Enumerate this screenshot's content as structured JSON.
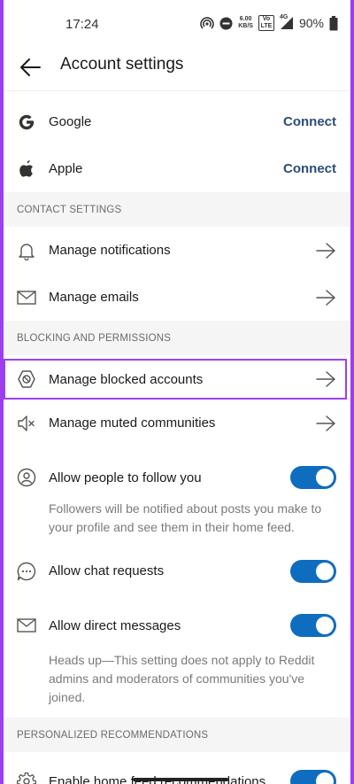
{
  "status_bar": {
    "time": "17:24",
    "net_speed_value": "6.00",
    "net_speed_unit": "KB/S",
    "volte": "Vo LTE",
    "network": "4G",
    "battery": "90%"
  },
  "header": {
    "title": "Account settings"
  },
  "connected_accounts": [
    {
      "label": "Google",
      "action": "Connect",
      "icon": "google-icon"
    },
    {
      "label": "Apple",
      "action": "Connect",
      "icon": "apple-icon"
    }
  ],
  "sections": {
    "contact": "CONTACT SETTINGS",
    "blocking": "BLOCKING AND PERMISSIONS",
    "personalized": "PERSONALIZED RECOMMENDATIONS"
  },
  "contact_items": [
    {
      "label": "Manage notifications",
      "icon": "bell-icon"
    },
    {
      "label": "Manage emails",
      "icon": "envelope-icon"
    }
  ],
  "blocking_items": {
    "blocked": "Manage blocked accounts",
    "muted": "Manage muted communities",
    "follow": "Allow people to follow you",
    "follow_desc": "Followers will be notified about posts you make to your profile and see them in their home feed.",
    "chat": "Allow chat requests",
    "dm": "Allow direct messages",
    "dm_desc": "Heads up—This setting does not apply to Reddit admins and moderators of communities you've joined."
  },
  "personalized_items": {
    "home_feed": "Enable home feed recommendations"
  },
  "toggles": {
    "follow": true,
    "chat": true,
    "dm": true,
    "home_feed": true
  },
  "colors": {
    "accent": "#0f6dbf",
    "highlight": "#9d3ff0",
    "connect": "#2a4d78"
  }
}
